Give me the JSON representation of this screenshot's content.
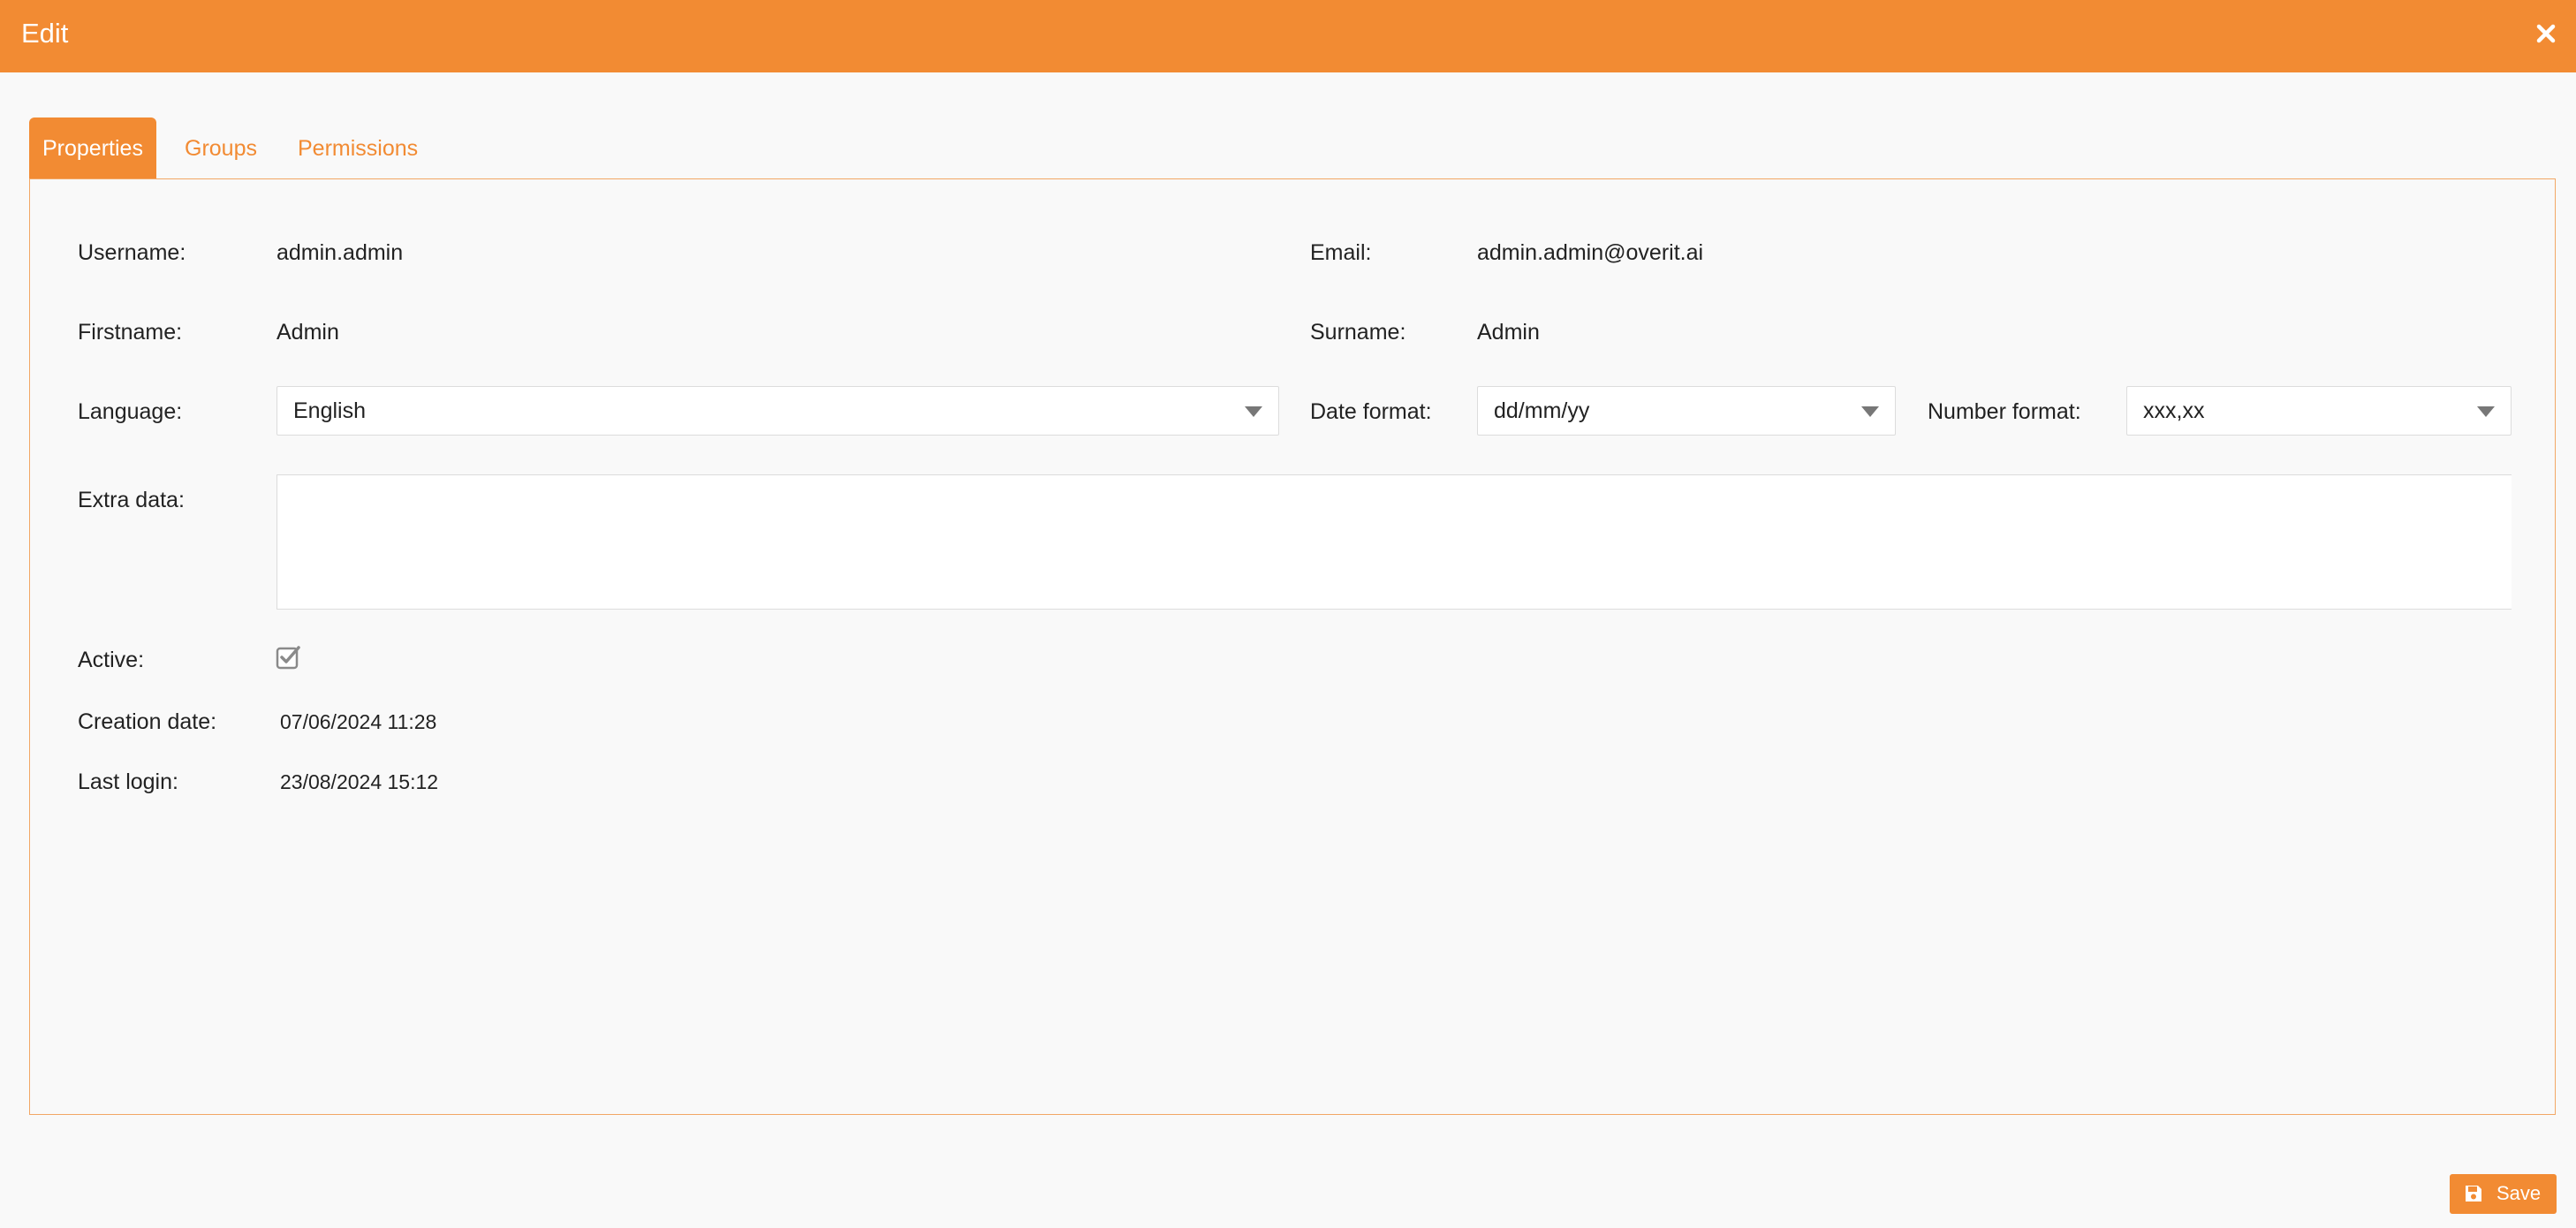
{
  "dialog": {
    "title": "Edit",
    "close_icon": "close-icon"
  },
  "tabs": [
    {
      "label": "Properties",
      "active": true
    },
    {
      "label": "Groups",
      "active": false
    },
    {
      "label": "Permissions",
      "active": false
    }
  ],
  "properties": {
    "username": {
      "label": "Username:",
      "value": "admin.admin"
    },
    "email": {
      "label": "Email:",
      "value": "admin.admin@overit.ai"
    },
    "firstname": {
      "label": "Firstname:",
      "value": "Admin"
    },
    "surname": {
      "label": "Surname:",
      "value": "Admin"
    },
    "language": {
      "label": "Language:",
      "selected": "English"
    },
    "date_format": {
      "label": "Date format:",
      "selected": "dd/mm/yy"
    },
    "number_format": {
      "label": "Number format:",
      "selected": "xxx,xx"
    },
    "extra_data": {
      "label": "Extra data:",
      "value": ""
    },
    "active": {
      "label": "Active:",
      "checked": true
    },
    "creation_date": {
      "label": "Creation date:",
      "value": "07/06/2024 11:28"
    },
    "last_login": {
      "label": "Last login:",
      "value": "23/08/2024 15:12"
    }
  },
  "footer": {
    "save_label": "Save",
    "save_icon": "floppy-disk-icon"
  },
  "colors": {
    "accent": "#f28b33",
    "panel_border": "#f2a765",
    "background": "#f9f9f9"
  }
}
